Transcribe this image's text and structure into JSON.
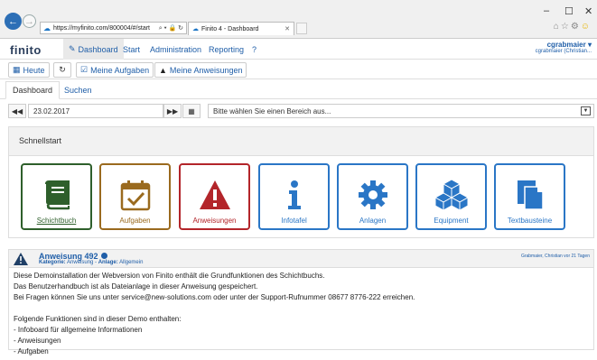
{
  "browser": {
    "url": "https://myfinito.com/800004/#/start",
    "tab_title": "Finito 4 - Dashboard",
    "window_controls": [
      "–",
      "☐",
      "✕"
    ]
  },
  "app": {
    "logo": "finito",
    "menu": [
      "Dashboard",
      "Start",
      "Administration",
      "Reporting",
      "?"
    ],
    "user_name": "cgrabmaier",
    "user_full": "cgrabmaier (Christian..."
  },
  "toolbar": {
    "today": "Heute",
    "my_tasks": "Meine Aufgaben",
    "my_instructions": "Meine Anweisungen"
  },
  "tabs": [
    "Dashboard",
    "Suchen"
  ],
  "filter": {
    "date": "23.02.2017",
    "area_placeholder": "Bitte wählen Sie einen Bereich aus..."
  },
  "quickstart": {
    "title": "Schnellstart",
    "tiles": [
      {
        "label": "Schichtbuch",
        "color": "#2e5f2b",
        "icon": "book-icon"
      },
      {
        "label": "Aufgaben",
        "color": "#9a6a1e",
        "icon": "calendar-check-icon"
      },
      {
        "label": "Anweisungen",
        "color": "#b3252a",
        "icon": "warning-icon"
      },
      {
        "label": "Infotafel",
        "color": "#2a76c6",
        "icon": "info-icon"
      },
      {
        "label": "Anlagen",
        "color": "#2a76c6",
        "icon": "gear-icon"
      },
      {
        "label": "Equipment",
        "color": "#2a76c6",
        "icon": "cubes-icon"
      },
      {
        "label": "Textbausteine",
        "color": "#2a76c6",
        "icon": "document-icon"
      }
    ]
  },
  "announcement": {
    "title": "Anweisung 492",
    "category_label": "Kategorie:",
    "category": "Anweisung",
    "facility_label": "Anlage:",
    "facility": "Allgemein",
    "meta": "Grabmaier, Christian vor 21 Tagen",
    "lines": [
      "Diese Demoinstallation der Webversion von Finito enthält die Grundfunktionen des Schichtbuchs.",
      "Das Benutzerhandbuch ist als Dateianlage in dieser Anweisung gespeichert.",
      "Bei Fragen können Sie uns unter service@new-solutions.com oder unter der Support-Rufnummer 08677 8776-222 erreichen.",
      "",
      "Folgende Funktionen sind in dieser Demo enthalten:",
      "- Infoboard für allgemeine Informationen",
      "- Anweisungen",
      "- Aufgaben"
    ]
  }
}
